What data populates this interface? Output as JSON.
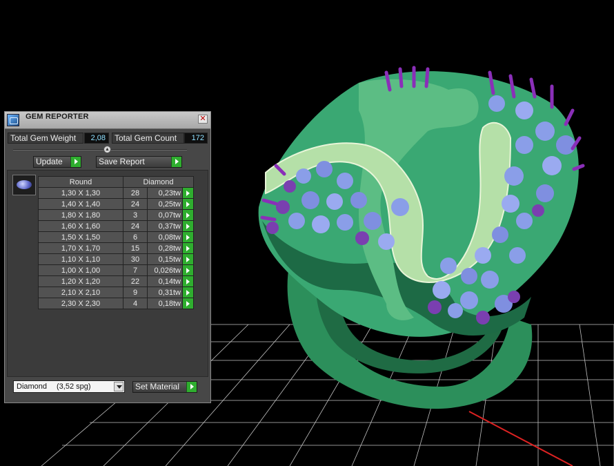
{
  "panel": {
    "title": "GEM REPORTER",
    "close_icon": "close-x-icon",
    "total_weight_label": "Total Gem Weight",
    "total_weight_value": "2,08",
    "total_count_label": "Total Gem Count",
    "total_count_value": "172",
    "update_label": "Update",
    "save_report_label": "Save Report",
    "table": {
      "headers": [
        "Round",
        "Diamond"
      ],
      "rows": [
        {
          "size": "1,30 X 1,30",
          "count": "28",
          "weight": "0,23tw"
        },
        {
          "size": "1,40 X 1,40",
          "count": "24",
          "weight": "0,25tw"
        },
        {
          "size": "1,80 X 1,80",
          "count": "3",
          "weight": "0,07tw"
        },
        {
          "size": "1,60 X 1,60",
          "count": "24",
          "weight": "0,37tw"
        },
        {
          "size": "1,50 X 1,50",
          "count": "6",
          "weight": "0,08tw"
        },
        {
          "size": "1,70 X 1,70",
          "count": "15",
          "weight": "0,28tw"
        },
        {
          "size": "1,10 X 1,10",
          "count": "30",
          "weight": "0,15tw"
        },
        {
          "size": "1,00 X 1,00",
          "count": "7",
          "weight": "0,026tw"
        },
        {
          "size": "1,20 X 1,20",
          "count": "22",
          "weight": "0,14tw"
        },
        {
          "size": "2,10 X 2,10",
          "count": "9",
          "weight": "0,31tw"
        },
        {
          "size": "2,30 X 2,30",
          "count": "4",
          "weight": "0,18tw"
        }
      ]
    },
    "material_name": "Diamond",
    "material_sg": "(3,52 spg)",
    "set_material_label": "Set Material"
  },
  "colors": {
    "accent_green": "#2fae2f",
    "value_cyan": "#8fe0ff",
    "ring_metal": "#2f9a62",
    "gem_violet": "#7a3fb0"
  }
}
